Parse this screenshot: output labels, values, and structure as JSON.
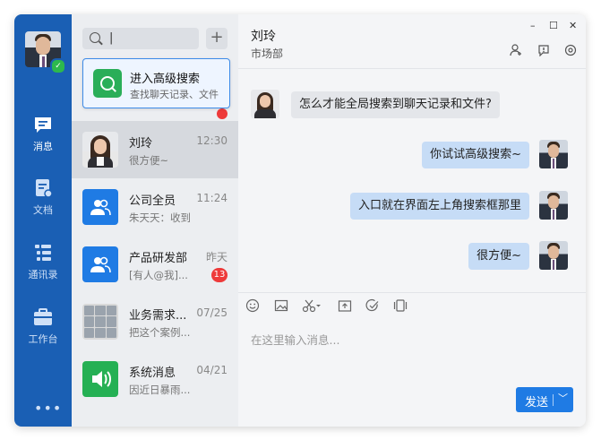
{
  "app": {
    "user_status_icon": "check-icon",
    "nav": [
      {
        "label": "消息",
        "icon": "message-icon",
        "active": true
      },
      {
        "label": "文档",
        "icon": "document-icon",
        "active": false
      },
      {
        "label": "通讯录",
        "icon": "contacts-icon",
        "active": false
      },
      {
        "label": "工作台",
        "icon": "workbench-icon",
        "active": false
      }
    ],
    "more_label": "•••"
  },
  "search": {
    "caret": "|",
    "add_label": "+",
    "popup": {
      "title": "进入高级搜索",
      "subtitle": "查找聊天记录、文件"
    }
  },
  "conversations": [
    {
      "name": "刘玲",
      "time": "12:30",
      "preview": "很方便~",
      "badge": "",
      "avatar": "woman-avatar",
      "selected": true
    },
    {
      "name": "公司全员",
      "time": "11:24",
      "preview": "朱天天：收到",
      "badge": "",
      "avatar": "group-icon"
    },
    {
      "name": "产品研发部",
      "time": "昨天",
      "preview": "[有人@我]...",
      "badge": "13",
      "avatar": "group-icon"
    },
    {
      "name": "业务需求...",
      "time": "07/25",
      "preview": "把这个案例...",
      "badge": "",
      "avatar": "group-grid-avatar"
    },
    {
      "name": "系统消息",
      "time": "04/21",
      "preview": "因近日暴雨...",
      "badge": "",
      "avatar": "speaker-icon"
    }
  ],
  "chat": {
    "title": "刘玲",
    "subtitle": "市场部",
    "window_controls": {
      "minimize": "–",
      "maximize": "☐",
      "close": "✕"
    },
    "messages": [
      {
        "direction": "in",
        "text": "怎么才能全局搜索到聊天记录和文件?"
      },
      {
        "direction": "out",
        "text": "你试试高级搜索~"
      },
      {
        "direction": "out",
        "text": "入口就在界面左上角搜索框那里"
      },
      {
        "direction": "out",
        "text": "很方便~"
      }
    ],
    "input_placeholder": "在这里输入消息...",
    "send_label": "发送",
    "send_chevron": "﹀"
  },
  "colors": {
    "rail": "#1a5fb4",
    "accent": "#1f7be4",
    "bubble_out": "#c6dcf6",
    "badge": "#ee3a3a",
    "search_icon": "#2aae58"
  }
}
